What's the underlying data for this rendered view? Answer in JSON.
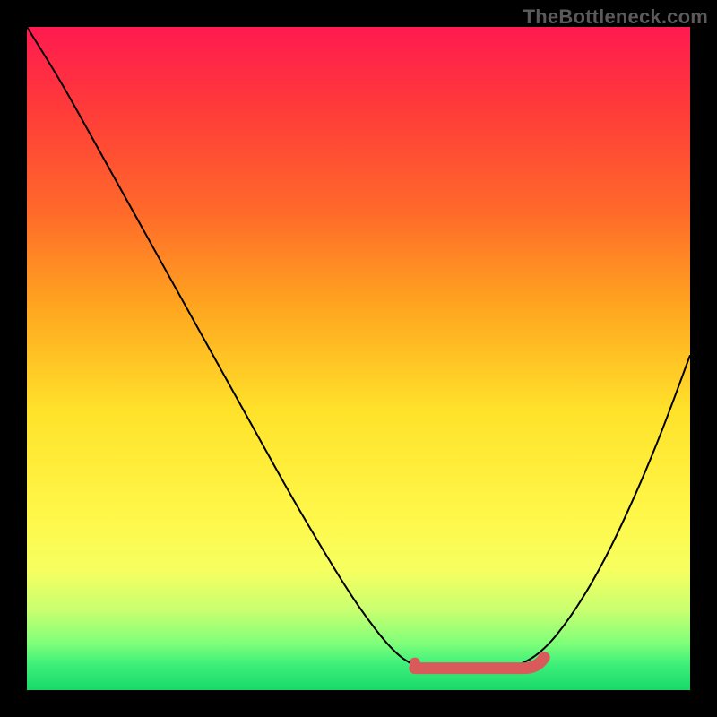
{
  "watermark": "TheBottleneck.com",
  "colors": {
    "accent_flat": "#d95a5a",
    "curve": "#000000"
  },
  "chart_data": {
    "type": "line",
    "title": "",
    "xlabel": "",
    "ylabel": "",
    "xlim": [
      0,
      1
    ],
    "ylim": [
      0,
      1
    ],
    "x": [
      0.0,
      0.05,
      0.1,
      0.15,
      0.2,
      0.25,
      0.3,
      0.35,
      0.4,
      0.45,
      0.5,
      0.55,
      0.585,
      0.62,
      0.66,
      0.7,
      0.74,
      0.78,
      0.82,
      0.86,
      0.9,
      0.95,
      1.0
    ],
    "values": [
      1.0,
      0.92,
      0.83,
      0.74,
      0.65,
      0.56,
      0.47,
      0.38,
      0.29,
      0.205,
      0.125,
      0.06,
      0.035,
      0.03,
      0.03,
      0.03,
      0.035,
      0.06,
      0.11,
      0.175,
      0.255,
      0.37,
      0.505
    ],
    "flat_segment": {
      "x": [
        0.585,
        0.78
      ],
      "y": 0.033
    },
    "gradient_stops": [
      {
        "pos": 0.0,
        "color": "#ff1a50"
      },
      {
        "pos": 0.5,
        "color": "#ffe22a"
      },
      {
        "pos": 1.0,
        "color": "#18d86a"
      }
    ]
  }
}
